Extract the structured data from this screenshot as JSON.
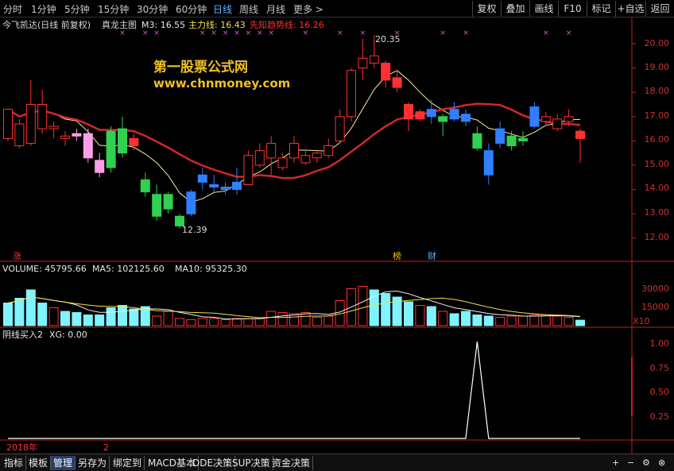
{
  "toolbar": {
    "periods": [
      "分时",
      "1分钟",
      "5分钟",
      "15分钟",
      "30分钟",
      "60分钟",
      "日线",
      "周线",
      "月线",
      "更多 >"
    ],
    "active_period": "日线",
    "buttons": [
      "复权",
      "叠加",
      "画线",
      "F10",
      "标记",
      "+自选",
      "返回"
    ]
  },
  "main_chart": {
    "header": {
      "stock": "今飞凯达(日线 前复权)",
      "indicator": "真龙主图",
      "m3": "M3: 16.55",
      "main_line": "主力线: 16.43",
      "trend_line": "先知趋势线: 16.26"
    },
    "watermark_title": "第一股票公式网",
    "watermark_url": "www.chnmoney.com",
    "high_label": "20.35",
    "low_label": "12.39",
    "y_ticks": [
      "20.00",
      "19.00",
      "18.00",
      "17.00",
      "16.00",
      "15.00",
      "14.00",
      "13.00",
      "12.00"
    ],
    "markers": {
      "zhang": "涨",
      "bang": "榜",
      "cai": "财"
    }
  },
  "volume_chart": {
    "header": {
      "volume": "VOLUME: 45795.66",
      "ma5": "MA5: 102125.60",
      "ma10": "MA10: 95325.30"
    },
    "y_ticks": [
      "30000",
      "15000"
    ],
    "unit": "X10"
  },
  "signal_chart": {
    "header": {
      "name": "阴线买入2",
      "xg": "XG: 0.00"
    },
    "y_ticks": [
      "1.00",
      "0.75",
      "0.50",
      "0.25"
    ]
  },
  "date_axis": {
    "year": "2018年",
    "month": "2"
  },
  "bottom_tabs": [
    "指标",
    "模板",
    "管理",
    "另存为",
    "绑定到",
    "MACD基本",
    "DDE决策",
    "SUP决策",
    "资金决策"
  ],
  "active_tab": "管理",
  "colors": {
    "up": "#ff3030",
    "down": "#30d050",
    "blue": "#2f7fff",
    "pink": "#ff9ee8",
    "cyan": "#7ff4ff",
    "axis": "#c02020",
    "highlight": "#5ab4ff"
  },
  "chart_data": {
    "type": "candlestick",
    "y_range": [
      11.8,
      20.5
    ],
    "candles": [
      {
        "o": 16.1,
        "c": 17.3,
        "h": 17.3,
        "l": 16.0,
        "col": "up"
      },
      {
        "o": 15.8,
        "c": 16.7,
        "h": 16.9,
        "l": 15.7,
        "col": "up"
      },
      {
        "o": 15.9,
        "c": 17.5,
        "h": 18.5,
        "l": 15.8,
        "col": "up"
      },
      {
        "o": 16.5,
        "c": 17.5,
        "h": 18.1,
        "l": 16.3,
        "col": "up"
      },
      {
        "o": 16.5,
        "c": 16.6,
        "h": 16.8,
        "l": 16.1,
        "col": "up"
      },
      {
        "o": 16.1,
        "c": 16.2,
        "h": 16.4,
        "l": 15.8,
        "col": "up"
      },
      {
        "o": 16.2,
        "c": 16.3,
        "h": 16.5,
        "l": 16.0,
        "col": "pink"
      },
      {
        "o": 16.3,
        "c": 15.3,
        "h": 16.5,
        "l": 15.1,
        "col": "pink"
      },
      {
        "o": 15.2,
        "c": 14.7,
        "h": 15.5,
        "l": 14.5,
        "col": "pink"
      },
      {
        "o": 14.9,
        "c": 16.4,
        "h": 16.6,
        "l": 14.7,
        "col": "down"
      },
      {
        "o": 15.5,
        "c": 16.5,
        "h": 17.0,
        "l": 15.3,
        "col": "down"
      },
      {
        "o": 16.1,
        "c": 15.8,
        "h": 16.3,
        "l": 15.6,
        "col": "up"
      },
      {
        "o": 14.4,
        "c": 13.9,
        "h": 14.7,
        "l": 13.7,
        "col": "down"
      },
      {
        "o": 13.8,
        "c": 12.9,
        "h": 14.2,
        "l": 12.7,
        "col": "down"
      },
      {
        "o": 13.2,
        "c": 13.8,
        "h": 13.9,
        "l": 13.0,
        "col": "down"
      },
      {
        "o": 12.5,
        "c": 12.9,
        "h": 13.0,
        "l": 12.4,
        "col": "down"
      },
      {
        "o": 13.0,
        "c": 13.9,
        "h": 14.0,
        "l": 12.9,
        "col": "blue"
      },
      {
        "o": 14.3,
        "c": 14.6,
        "h": 14.9,
        "l": 14.0,
        "col": "blue"
      },
      {
        "o": 14.1,
        "c": 14.2,
        "h": 14.6,
        "l": 13.9,
        "col": "blue"
      },
      {
        "o": 14.0,
        "c": 14.1,
        "h": 14.3,
        "l": 13.8,
        "col": "blue"
      },
      {
        "o": 14.0,
        "c": 14.3,
        "h": 14.9,
        "l": 13.8,
        "col": "blue"
      },
      {
        "o": 14.2,
        "c": 15.4,
        "h": 15.6,
        "l": 14.2,
        "col": "up"
      },
      {
        "o": 15.0,
        "c": 15.6,
        "h": 15.9,
        "l": 14.9,
        "col": "up"
      },
      {
        "o": 15.3,
        "c": 15.9,
        "h": 16.2,
        "l": 14.6,
        "col": "up"
      },
      {
        "o": 14.9,
        "c": 15.3,
        "h": 15.5,
        "l": 14.8,
        "col": "up"
      },
      {
        "o": 15.3,
        "c": 15.9,
        "h": 16.2,
        "l": 15.1,
        "col": "up"
      },
      {
        "o": 15.1,
        "c": 15.4,
        "h": 15.6,
        "l": 15.0,
        "col": "up"
      },
      {
        "o": 15.3,
        "c": 15.5,
        "h": 15.6,
        "l": 15.1,
        "col": "up"
      },
      {
        "o": 15.4,
        "c": 15.8,
        "h": 16.1,
        "l": 15.3,
        "col": "up"
      },
      {
        "o": 16.0,
        "c": 17.0,
        "h": 17.3,
        "l": 15.9,
        "col": "up"
      },
      {
        "o": 17.0,
        "c": 18.9,
        "h": 19.0,
        "l": 16.8,
        "col": "up"
      },
      {
        "o": 19.0,
        "c": 19.4,
        "h": 20.2,
        "l": 18.5,
        "col": "up"
      },
      {
        "o": 19.2,
        "c": 19.5,
        "h": 20.35,
        "l": 19.0,
        "col": "up"
      },
      {
        "o": 19.2,
        "c": 18.5,
        "h": 19.3,
        "l": 18.2,
        "col": "up"
      },
      {
        "o": 18.6,
        "c": 18.2,
        "h": 18.9,
        "l": 18.0,
        "col": "up"
      },
      {
        "o": 17.5,
        "c": 16.9,
        "h": 17.6,
        "l": 16.4,
        "col": "up"
      },
      {
        "o": 17.2,
        "c": 16.9,
        "h": 17.3,
        "l": 16.8,
        "col": "up"
      },
      {
        "o": 17.0,
        "c": 17.3,
        "h": 17.7,
        "l": 16.7,
        "col": "blue"
      },
      {
        "o": 16.8,
        "c": 17.0,
        "h": 17.1,
        "l": 16.2,
        "col": "down"
      },
      {
        "o": 17.3,
        "c": 16.9,
        "h": 17.6,
        "l": 16.8,
        "col": "blue"
      },
      {
        "o": 17.1,
        "c": 16.8,
        "h": 17.3,
        "l": 16.6,
        "col": "blue"
      },
      {
        "o": 15.7,
        "c": 16.3,
        "h": 16.6,
        "l": 15.6,
        "col": "down"
      },
      {
        "o": 14.6,
        "c": 15.6,
        "h": 15.9,
        "l": 14.2,
        "col": "blue"
      },
      {
        "o": 15.9,
        "c": 16.5,
        "h": 16.8,
        "l": 15.7,
        "col": "blue"
      },
      {
        "o": 15.8,
        "c": 16.2,
        "h": 16.4,
        "l": 15.6,
        "col": "down"
      },
      {
        "o": 16.0,
        "c": 16.1,
        "h": 16.4,
        "l": 15.8,
        "col": "down"
      },
      {
        "o": 16.6,
        "c": 17.4,
        "h": 17.6,
        "l": 16.5,
        "col": "blue"
      },
      {
        "o": 16.8,
        "c": 17.0,
        "h": 17.2,
        "l": 16.6,
        "col": "up"
      },
      {
        "o": 16.5,
        "c": 16.9,
        "h": 17.1,
        "l": 16.4,
        "col": "up"
      },
      {
        "o": 16.8,
        "c": 17.0,
        "h": 17.3,
        "l": 16.6,
        "col": "up"
      },
      {
        "o": 16.4,
        "c": 16.1,
        "h": 16.5,
        "l": 15.1,
        "col": "up"
      }
    ],
    "volumes": [
      19000,
      23000,
      30000,
      19000,
      15000,
      12000,
      11000,
      9000,
      9000,
      15000,
      17000,
      14000,
      16000,
      8000,
      12000,
      6000,
      5000,
      6000,
      6000,
      5000,
      6000,
      6000,
      6000,
      12000,
      11000,
      10000,
      11000,
      7000,
      8000,
      21000,
      31000,
      33000,
      30000,
      27000,
      24000,
      20000,
      17000,
      16000,
      12000,
      10000,
      12000,
      9000,
      8000,
      7000,
      8000,
      8000,
      9000,
      9000,
      8000,
      7000,
      4600
    ],
    "volume_colors": [
      "cyan",
      "cyan",
      "cyan",
      "cyan",
      "up",
      "cyan",
      "cyan",
      "cyan",
      "cyan",
      "cyan",
      "cyan",
      "cyan",
      "cyan",
      "up",
      "up",
      "up",
      "up",
      "up",
      "up",
      "up",
      "up",
      "up",
      "up",
      "up",
      "up",
      "up",
      "up",
      "up",
      "up",
      "up",
      "up",
      "up",
      "cyan",
      "cyan",
      "cyan",
      "cyan",
      "up",
      "cyan",
      "up",
      "cyan",
      "cyan",
      "cyan",
      "cyan",
      "up",
      "up",
      "up",
      "up",
      "up",
      "up",
      "up",
      "cyan"
    ],
    "signal": [
      0,
      0,
      0,
      0,
      0,
      0,
      0,
      0,
      0,
      0,
      0,
      0,
      0,
      0,
      0,
      0,
      0,
      0,
      0,
      0,
      0,
      0,
      0,
      0,
      0,
      0,
      0,
      0,
      0,
      0,
      0,
      0,
      0,
      0,
      0,
      0,
      0,
      0,
      0,
      0,
      0,
      1,
      0,
      0,
      0,
      0,
      0,
      0,
      0,
      0,
      0
    ]
  }
}
